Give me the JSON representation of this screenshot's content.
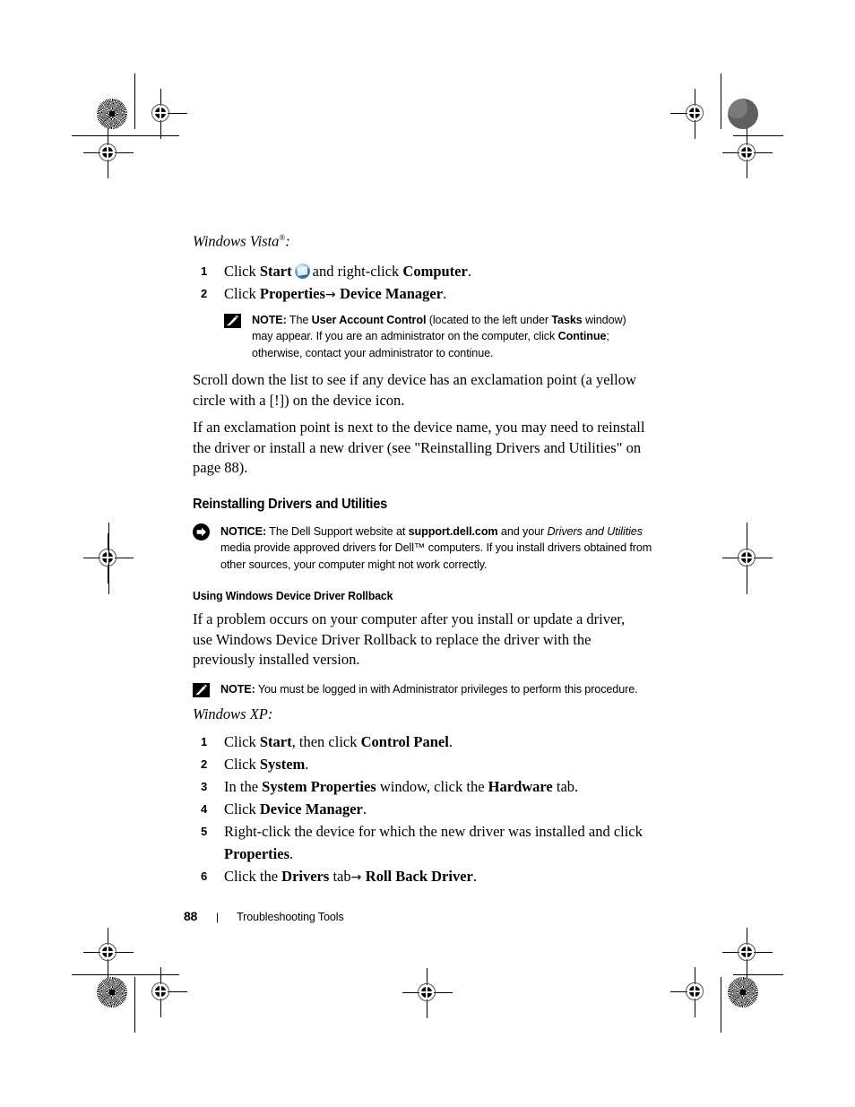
{
  "document": {
    "vista_heading": "Windows Vista",
    "vista_heading_sup": "®",
    "vista_heading_colon": ":",
    "xp_heading": "Windows XP:"
  },
  "vista_steps": [
    {
      "num": "1",
      "parts": [
        {
          "t": "Click ",
          "s": "plain"
        },
        {
          "t": "Start",
          "s": "bold"
        },
        {
          "t": "start-orb",
          "s": "icon"
        },
        {
          "t": "and right-click ",
          "s": "plain"
        },
        {
          "t": "Computer",
          "s": "bold"
        },
        {
          "t": ".",
          "s": "plain"
        }
      ]
    },
    {
      "num": "2",
      "parts": [
        {
          "t": "Click ",
          "s": "plain"
        },
        {
          "t": "Properties",
          "s": "bold"
        },
        {
          "t": "→ ",
          "s": "arrow"
        },
        {
          "t": "Device Manager",
          "s": "bold"
        },
        {
          "t": ".",
          "s": "plain"
        }
      ]
    }
  ],
  "note_vista": {
    "label": "NOTE:",
    "parts": [
      {
        "t": " The ",
        "s": "plain"
      },
      {
        "t": "User Account Control",
        "s": "bold"
      },
      {
        "t": " (located to the left under ",
        "s": "plain"
      },
      {
        "t": "Tasks",
        "s": "bold"
      },
      {
        "t": " window) may appear. If you are an administrator on the computer, click ",
        "s": "plain"
      },
      {
        "t": "Continue",
        "s": "bold"
      },
      {
        "t": "; otherwise, contact your administrator to continue.",
        "s": "plain"
      }
    ]
  },
  "paragraphs": {
    "scroll_down": "Scroll down the list to see if any device has an exclamation point (a yellow circle with a [!]) on the device icon.",
    "exclamation": "If an exclamation point is next to the device name, you may need to reinstall the driver or install a new driver (see \"Reinstalling Drivers and Utilities\" on page 88).",
    "rollback_intro": "If a problem occurs on your computer after you install or update a driver, use Windows Device Driver Rollback to replace the driver with the previously installed version."
  },
  "headings": {
    "section": "Reinstalling Drivers and Utilities",
    "subsection": "Using Windows Device Driver Rollback"
  },
  "notice": {
    "label": "NOTICE:",
    "parts": [
      {
        "t": " The Dell Support website at ",
        "s": "plain"
      },
      {
        "t": "support.dell.com",
        "s": "bold"
      },
      {
        "t": " and your ",
        "s": "plain"
      },
      {
        "t": "Drivers and Utilities",
        "s": "italic"
      },
      {
        "t": " media provide approved drivers for Dell™ computers. If you install drivers obtained from other sources, your computer might not work correctly.",
        "s": "plain"
      }
    ]
  },
  "note_admin": {
    "label": "NOTE:",
    "parts": [
      {
        "t": " You must be logged in with Administrator privileges to perform this procedure.",
        "s": "plain"
      }
    ]
  },
  "xp_steps": [
    {
      "num": "1",
      "parts": [
        {
          "t": "Click ",
          "s": "plain"
        },
        {
          "t": "Start",
          "s": "bold"
        },
        {
          "t": ", then click ",
          "s": "plain"
        },
        {
          "t": "Control Panel",
          "s": "bold"
        },
        {
          "t": ".",
          "s": "plain"
        }
      ]
    },
    {
      "num": "2",
      "parts": [
        {
          "t": "Click ",
          "s": "plain"
        },
        {
          "t": "System",
          "s": "bold"
        },
        {
          "t": ".",
          "s": "plain"
        }
      ]
    },
    {
      "num": "3",
      "parts": [
        {
          "t": "In the ",
          "s": "plain"
        },
        {
          "t": "System Properties",
          "s": "bold"
        },
        {
          "t": " window, click the ",
          "s": "plain"
        },
        {
          "t": "Hardware",
          "s": "bold"
        },
        {
          "t": " tab.",
          "s": "plain"
        }
      ]
    },
    {
      "num": "4",
      "parts": [
        {
          "t": "Click ",
          "s": "plain"
        },
        {
          "t": "Device Manager",
          "s": "bold"
        },
        {
          "t": ".",
          "s": "plain"
        }
      ]
    },
    {
      "num": "5",
      "parts": [
        {
          "t": "Right-click the device for which the new driver was installed and click ",
          "s": "plain"
        },
        {
          "t": "Properties",
          "s": "bold"
        },
        {
          "t": ".",
          "s": "plain"
        }
      ]
    },
    {
      "num": "6",
      "parts": [
        {
          "t": "Click the ",
          "s": "plain"
        },
        {
          "t": "Drivers",
          "s": "bold"
        },
        {
          "t": " tab",
          "s": "plain"
        },
        {
          "t": "→ ",
          "s": "arrow"
        },
        {
          "t": "Roll Back Driver",
          "s": "bold"
        },
        {
          "t": ".",
          "s": "plain"
        }
      ]
    }
  ],
  "footer": {
    "page_number": "88",
    "separator": "|",
    "title": "Troubleshooting Tools"
  },
  "colors": {
    "text": "#000000",
    "page_background": "#ffffff",
    "registration_mark": "#000000",
    "halftone_dot": "#666666"
  }
}
